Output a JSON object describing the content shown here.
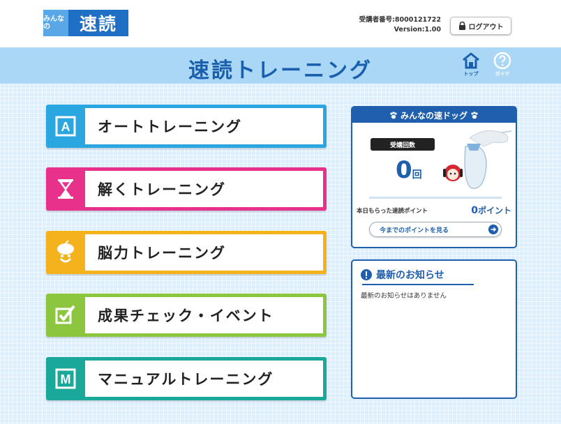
{
  "header": {
    "logo_mini": "みんなの",
    "logo_main": "速読",
    "user_id_line": "受講者番号:8000121722",
    "version_line": "Version:1.00",
    "logout_label": "ログアウト"
  },
  "title_band": {
    "title": "速読トレーニング",
    "top_label": "トップ",
    "guide_label": "ガイド"
  },
  "menu": {
    "auto": {
      "icon_letter": "A",
      "label": "オートトレーニング",
      "color": "#2aa6e0"
    },
    "solve": {
      "label": "解くトレーニング",
      "color": "#e8318a"
    },
    "brain": {
      "label": "脳力トレーニング",
      "color": "#f4b21c"
    },
    "result": {
      "label": "成果チェック・イベント",
      "color": "#8cc63f"
    },
    "manual": {
      "icon_letter": "M",
      "label": "マニュアルトレーニング",
      "color": "#1aa89a"
    }
  },
  "dog_card": {
    "title": "みんなの速ドッグ",
    "badge": "受講回数",
    "count": "0",
    "count_unit": "回",
    "points_label": "本日もらった速読ポイント",
    "points_value": "0",
    "points_unit": "ポイント",
    "points_button": "今までのポイントを見る"
  },
  "news_card": {
    "title": "最新のお知らせ",
    "body": "最新のお知らせはありません"
  },
  "colors": {
    "accent": "#1f5fad",
    "band": "#a9d7f5",
    "background": "#dcefff"
  }
}
